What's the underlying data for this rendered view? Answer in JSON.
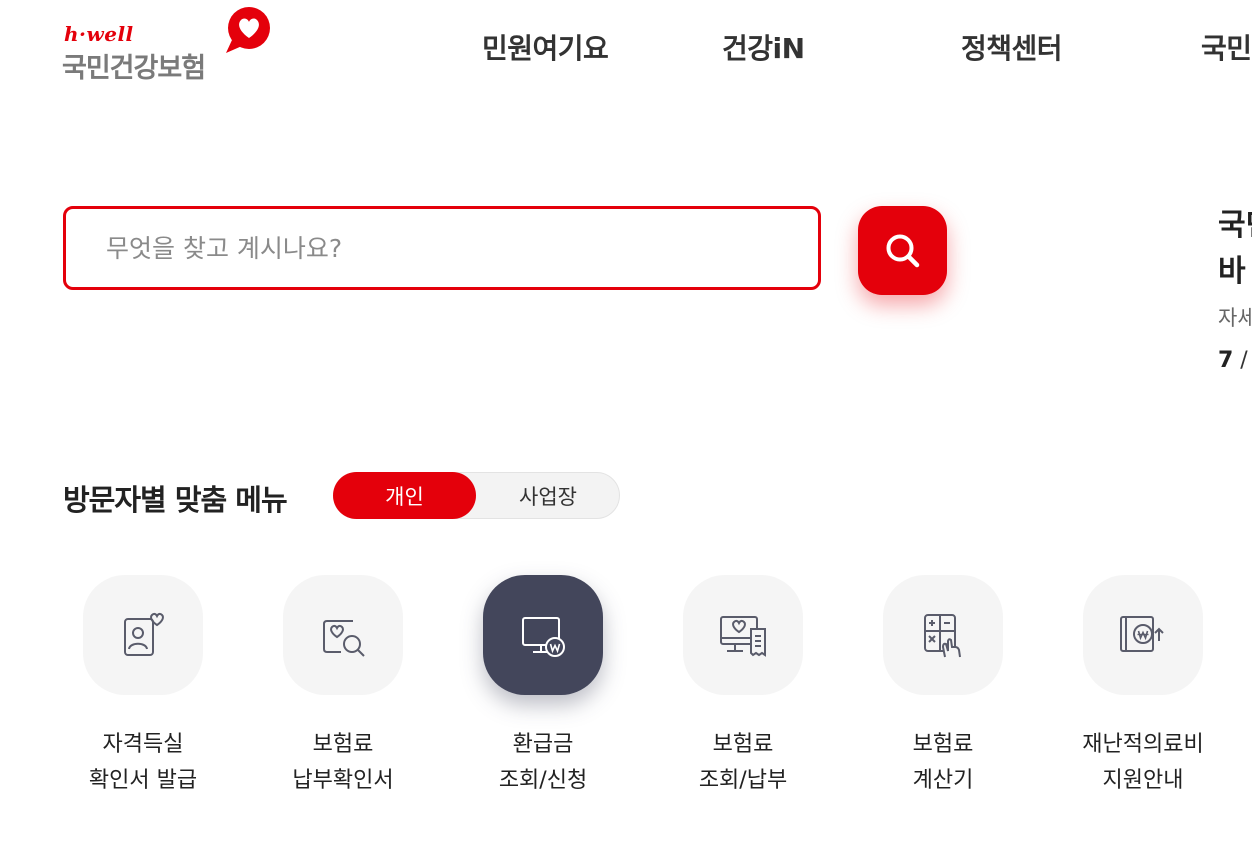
{
  "header": {
    "logo": {
      "en": "h·well",
      "ko": "국민건강보험"
    },
    "nav": [
      "민원여기요",
      "건강iN",
      "정책센터",
      "국민"
    ]
  },
  "search": {
    "placeholder": "무엇을 찾고 계시나요?",
    "icon": "search-icon"
  },
  "notice": {
    "title_line1": "국민",
    "title_line2": "바",
    "sub": "자세",
    "page_current": "7",
    "page_sep": " /"
  },
  "section": {
    "title": "방문자별 맞춤 메뉴",
    "toggle": {
      "active": "개인",
      "inactive": "사업장"
    }
  },
  "menu": [
    {
      "line1": "자격득실",
      "line2": "확인서 발급",
      "icon": "id-card-heart-icon"
    },
    {
      "line1": "보험료",
      "line2": "납부확인서",
      "icon": "document-search-icon"
    },
    {
      "line1": "환급금",
      "line2": "조회/신청",
      "icon": "monitor-won-icon",
      "active": true
    },
    {
      "line1": "보험료",
      "line2": "조회/납부",
      "icon": "monitor-receipt-icon"
    },
    {
      "line1": "보험료",
      "line2": "계산기",
      "icon": "calculator-hand-icon"
    },
    {
      "line1": "재난적의료비",
      "line2": "지원안내",
      "icon": "book-won-icon"
    }
  ],
  "colors": {
    "brand": "#e4000b",
    "active_tile": "#43465b",
    "tile": "#f5f5f5",
    "icon_stroke": "#5a5c6b"
  }
}
